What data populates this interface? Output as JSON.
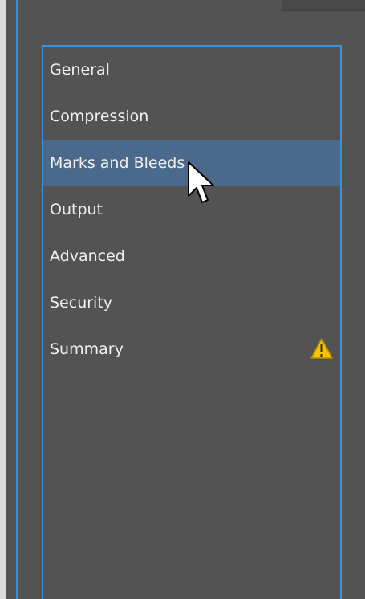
{
  "panel": {
    "items": [
      {
        "label": "General"
      },
      {
        "label": "Compression"
      },
      {
        "label": "Marks and Bleeds"
      },
      {
        "label": "Output"
      },
      {
        "label": "Advanced"
      },
      {
        "label": "Security"
      },
      {
        "label": "Summary"
      }
    ],
    "selected_index": 2,
    "summary_status_icon": "warning-icon"
  },
  "colors": {
    "background": "#535353",
    "accent": "#3d8fdc",
    "selected": "#4b6a8b",
    "warning": "#f5c400"
  },
  "pointer": "arrow-cursor-icon"
}
